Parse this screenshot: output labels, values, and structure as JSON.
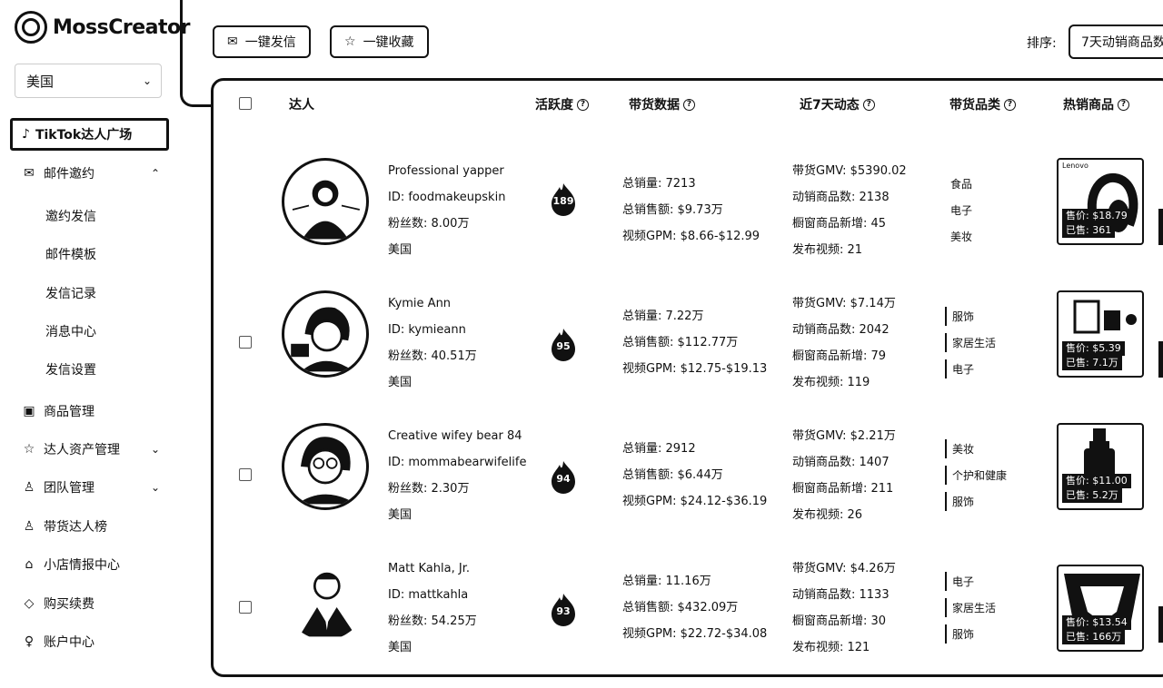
{
  "app": {
    "logo_text": "MossCreator"
  },
  "country_select": {
    "value": "美国"
  },
  "sidebar": {
    "active": "TikTok达人广场",
    "items": [
      {
        "label": "邮件邀约",
        "icon": "mail-icon",
        "arrow": "⌃"
      },
      {
        "label": "邀约发信"
      },
      {
        "label": "邮件模板"
      },
      {
        "label": "发信记录"
      },
      {
        "label": "消息中心"
      },
      {
        "label": "发信设置"
      },
      {
        "label": "商品管理",
        "icon": "shop-icon"
      },
      {
        "label": "达人资产管理",
        "icon": "star-icon",
        "arrow": "⌄"
      },
      {
        "label": "团队管理",
        "icon": "team-icon",
        "arrow": "⌄"
      },
      {
        "label": "带货达人榜",
        "icon": "user-icon"
      },
      {
        "label": "小店情报中心",
        "icon": "store-icon"
      },
      {
        "label": "购买续费",
        "icon": "diamond-icon"
      },
      {
        "label": "账户中心",
        "icon": "account-icon"
      }
    ]
  },
  "toolbar": {
    "bulk_send": "一键发信",
    "bulk_fav": "一键收藏",
    "sort_label": "排序:",
    "sort_value": "7天动销商品数"
  },
  "table": {
    "headers": {
      "creator": "达人",
      "activity": "活跃度",
      "sales": "带货数据",
      "recent": "近7天动态",
      "category": "带货品类",
      "hot": "热销商品"
    },
    "rows": [
      {
        "name": "Professional yapper",
        "id": "ID: foodmakeupskin",
        "fans": "粉丝数: 8.00万",
        "country": "美国",
        "activity": "189",
        "total_sales": "总销量:  7213",
        "total_amount": "总销售额:  $9.73万",
        "gpm": "视频GPM:   $8.66-$12.99",
        "gmv": "带货GMV:  $5390.02",
        "moving": "动销商品数:  2138",
        "new_items": "橱窗商品新增:  45",
        "videos": "发布视频:  21",
        "cats": [
          "食品",
          "电子",
          "美妆"
        ],
        "cats_style": "plain",
        "prod_brand": "Lenovo",
        "prod_price": "售价: $18.79",
        "prod_sold": "已售: 361"
      },
      {
        "name": "Kymie Ann",
        "id": "ID: kymieann",
        "fans": "粉丝数: 40.51万",
        "country": "美国",
        "activity": "95",
        "total_sales": "总销量:  7.22万",
        "total_amount": "总销售额:  $112.77万",
        "gpm": "视频GPM:   $12.75-$19.13",
        "gmv": "带货GMV:  $7.14万",
        "moving": "动销商品数:  2042",
        "new_items": "橱窗商品新增:  79",
        "videos": "发布视频:  119",
        "cats": [
          "服饰",
          "家居生活",
          "电子"
        ],
        "cats_style": "tag",
        "prod_brand": "",
        "prod_price": "售价: $5.39",
        "prod_sold": "已售: 7.1万"
      },
      {
        "name": "Creative wifey bear 84",
        "id": "ID: mommabearwifelife",
        "fans": "粉丝数: 2.30万",
        "country": "美国",
        "activity": "94",
        "total_sales": "总销量:  2912",
        "total_amount": "总销售额:  $6.44万",
        "gpm": "视频GPM:   $24.12-$36.19",
        "gmv": "带货GMV:  $2.21万",
        "moving": "动销商品数:  1407",
        "new_items": "橱窗商品新增:  211",
        "videos": "发布视频:  26",
        "cats": [
          "美妆",
          "个护和健康",
          "服饰"
        ],
        "cats_style": "tag",
        "prod_brand": "",
        "prod_price": "售价: $11.00",
        "prod_sold": "已售: 5.2万"
      },
      {
        "name": "Matt Kahla, Jr.",
        "id": "ID: mattkahla",
        "fans": "粉丝数: 54.25万",
        "country": "美国",
        "activity": "93",
        "total_sales": "总销量:  11.16万",
        "total_amount": "总销售额:  $432.09万",
        "gpm": "视频GPM:   $22.72-$34.08",
        "gmv": "带货GMV:  $4.26万",
        "moving": "动销商品数:  1133",
        "new_items": "橱窗商品新增:  30",
        "videos": "发布视频:  121",
        "cats": [
          "电子",
          "家居生活",
          "服饰"
        ],
        "cats_style": "tag",
        "prod_brand": "",
        "prod_price": "售价: $13.54",
        "prod_sold": "已售: 166万"
      }
    ]
  }
}
